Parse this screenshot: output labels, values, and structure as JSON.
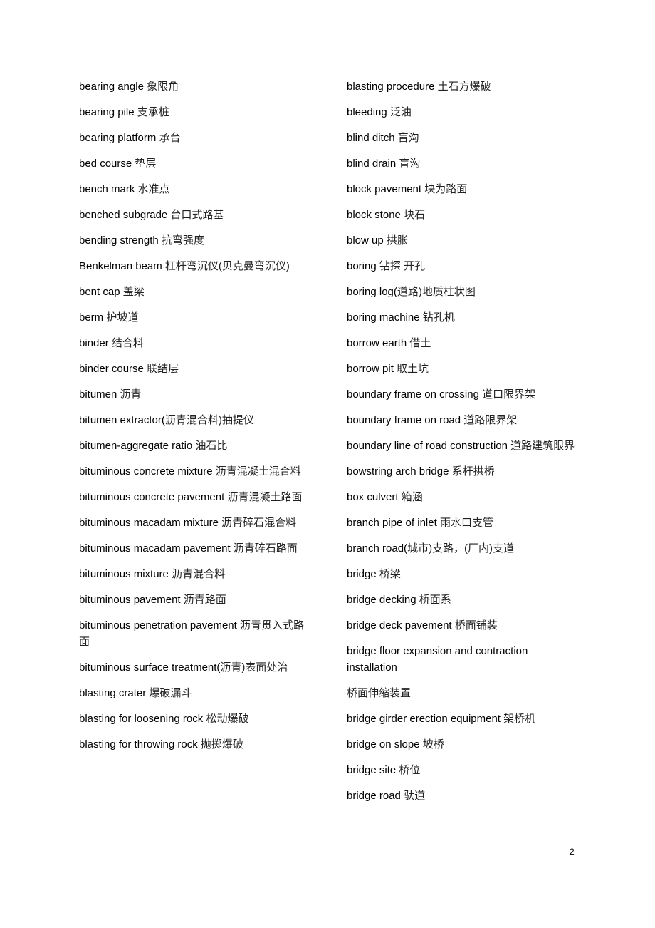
{
  "document": {
    "page_number": "2",
    "left_column": [
      {
        "en": "bearing angle",
        "zh": "象限角"
      },
      {
        "en": "bearing pile",
        "zh": "支承桩"
      },
      {
        "en": "bearing platform",
        "zh": "承台"
      },
      {
        "en": "bed course",
        "zh": "垫层"
      },
      {
        "en": "bench mark",
        "zh": "水准点"
      },
      {
        "en": "benched subgrade",
        "zh": "台口式路基"
      },
      {
        "en": "bending strength",
        "zh": "抗弯强度"
      },
      {
        "en": "Benkelman beam",
        "zh": "杠杆弯沉仪(贝克曼弯沉仪)"
      },
      {
        "en": "bent cap",
        "zh": "盖梁"
      },
      {
        "en": "berm",
        "zh": "护坡道"
      },
      {
        "en": "binder",
        "zh": "结合料"
      },
      {
        "en": "binder course",
        "zh": "联结层"
      },
      {
        "en": "bitumen",
        "zh": "沥青"
      },
      {
        "en": "bitumen extractor(",
        "zh": "沥青混合料)抽提仪"
      },
      {
        "en": "bitumen-aggregate ratio",
        "zh": "油石比"
      },
      {
        "en": "bituminous concrete mixture",
        "zh": "沥青混凝土混合料"
      },
      {
        "en": "bituminous concrete pavement",
        "zh": "沥青混凝土路面"
      },
      {
        "en": "bituminous macadam mixture",
        "zh": "沥青碎石混合料"
      },
      {
        "en": "bituminous macadam pavement",
        "zh": "沥青碎石路面"
      },
      {
        "en": "bituminous mixture",
        "zh": "沥青混合料"
      },
      {
        "en": "bituminous pavement",
        "zh": "沥青路面"
      },
      {
        "en": "bituminous penetration pavement",
        "zh": "沥青贯入式路面"
      },
      {
        "en": "bituminous surface treatment(",
        "zh": "沥青)表面处治"
      },
      {
        "en": "blasting crater",
        "zh": "爆破漏斗"
      },
      {
        "en": "blasting for loosening rock",
        "zh": "松动爆破"
      },
      {
        "en": "blasting for throwing rock",
        "zh": "抛掷爆破"
      }
    ],
    "right_column": [
      {
        "en": "blasting procedure",
        "zh": "土石方爆破"
      },
      {
        "en": "bleeding",
        "zh": "泛油"
      },
      {
        "en": "blind ditch",
        "zh": "盲沟"
      },
      {
        "en": "blind drain",
        "zh": "盲沟"
      },
      {
        "en": "block pavement",
        "zh": "块为路面"
      },
      {
        "en": "block stone",
        "zh": "块石"
      },
      {
        "en": "blow up",
        "zh": "拱胀"
      },
      {
        "en": "boring",
        "zh": "钻探  开孔"
      },
      {
        "en": "boring log(",
        "zh": "道路)地质柱状图"
      },
      {
        "en": "boring machine",
        "zh": "钻孔机"
      },
      {
        "en": "borrow earth",
        "zh": "借土"
      },
      {
        "en": "borrow pit",
        "zh": "取土坑"
      },
      {
        "en": "boundary frame on crossing",
        "zh": "道口限界架"
      },
      {
        "en": "boundary frame on road",
        "zh": "道路限界架"
      },
      {
        "en": "boundary line of road construction",
        "zh": "道路建筑限界"
      },
      {
        "en": "bowstring arch bridge",
        "zh": "系杆拱桥"
      },
      {
        "en": "box culvert",
        "zh": "箱涵"
      },
      {
        "en": "branch pipe of inlet",
        "zh": "雨水口支管"
      },
      {
        "en": "branch road(",
        "zh": "城市)支路，(厂内)支道"
      },
      {
        "en": "bridge",
        "zh": "桥梁"
      },
      {
        "en": "bridge decking",
        "zh": "桥面系"
      },
      {
        "en": "bridge deck pavement",
        "zh": "桥面铺装"
      },
      {
        "en": "bridge floor expansion and contraction installation",
        "zh": ""
      },
      {
        "en": "",
        "zh": "桥面伸缩装置"
      },
      {
        "en": "bridge girder erection equipment",
        "zh": "架桥机"
      },
      {
        "en": "bridge on slope",
        "zh": "坡桥"
      },
      {
        "en": "bridge site",
        "zh": "桥位"
      },
      {
        "en": "bridge road",
        "zh": "驮道"
      }
    ]
  }
}
